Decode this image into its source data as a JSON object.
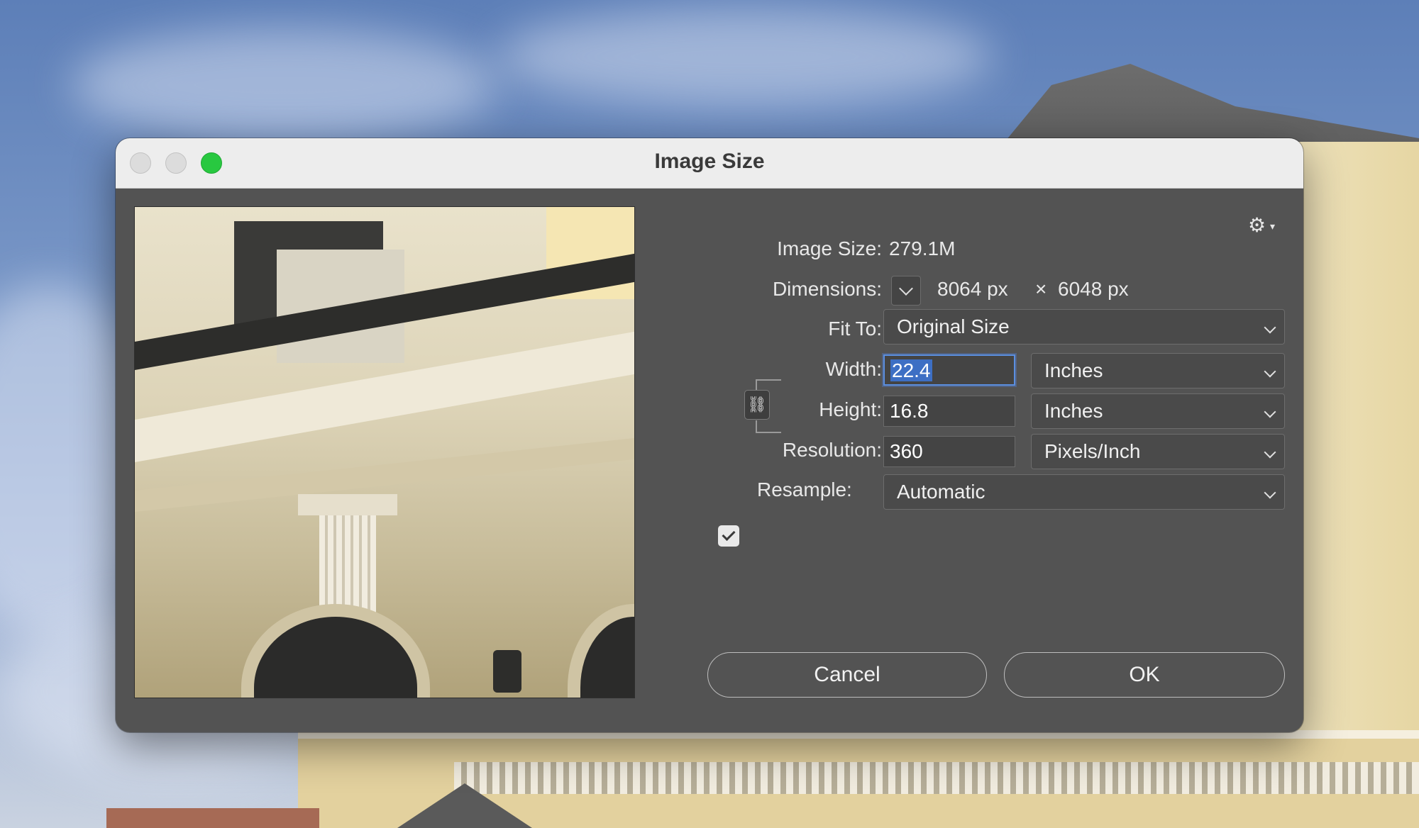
{
  "window": {
    "title": "Image Size"
  },
  "info": {
    "image_size_label": "Image Size:",
    "image_size_value": "279.1M",
    "dimensions_label": "Dimensions:",
    "dimensions_width": "8064 px",
    "dimensions_sep": "×",
    "dimensions_height": "6048 px"
  },
  "fields": {
    "fit_to_label": "Fit To:",
    "fit_to_value": "Original Size",
    "width_label": "Width:",
    "width_value": "22.4",
    "width_unit": "Inches",
    "height_label": "Height:",
    "height_value": "16.8",
    "height_unit": "Inches",
    "resolution_label": "Resolution:",
    "resolution_value": "360",
    "resolution_unit": "Pixels/Inch",
    "resample_label": "Resample:",
    "resample_checked": true,
    "resample_value": "Automatic"
  },
  "buttons": {
    "cancel": "Cancel",
    "ok": "OK"
  },
  "icons": {
    "gear": "gear-icon",
    "link": "link-icon"
  },
  "colors": {
    "dialog_bg": "#535353",
    "focus": "#5b8fe0",
    "maximize": "#28c840"
  }
}
